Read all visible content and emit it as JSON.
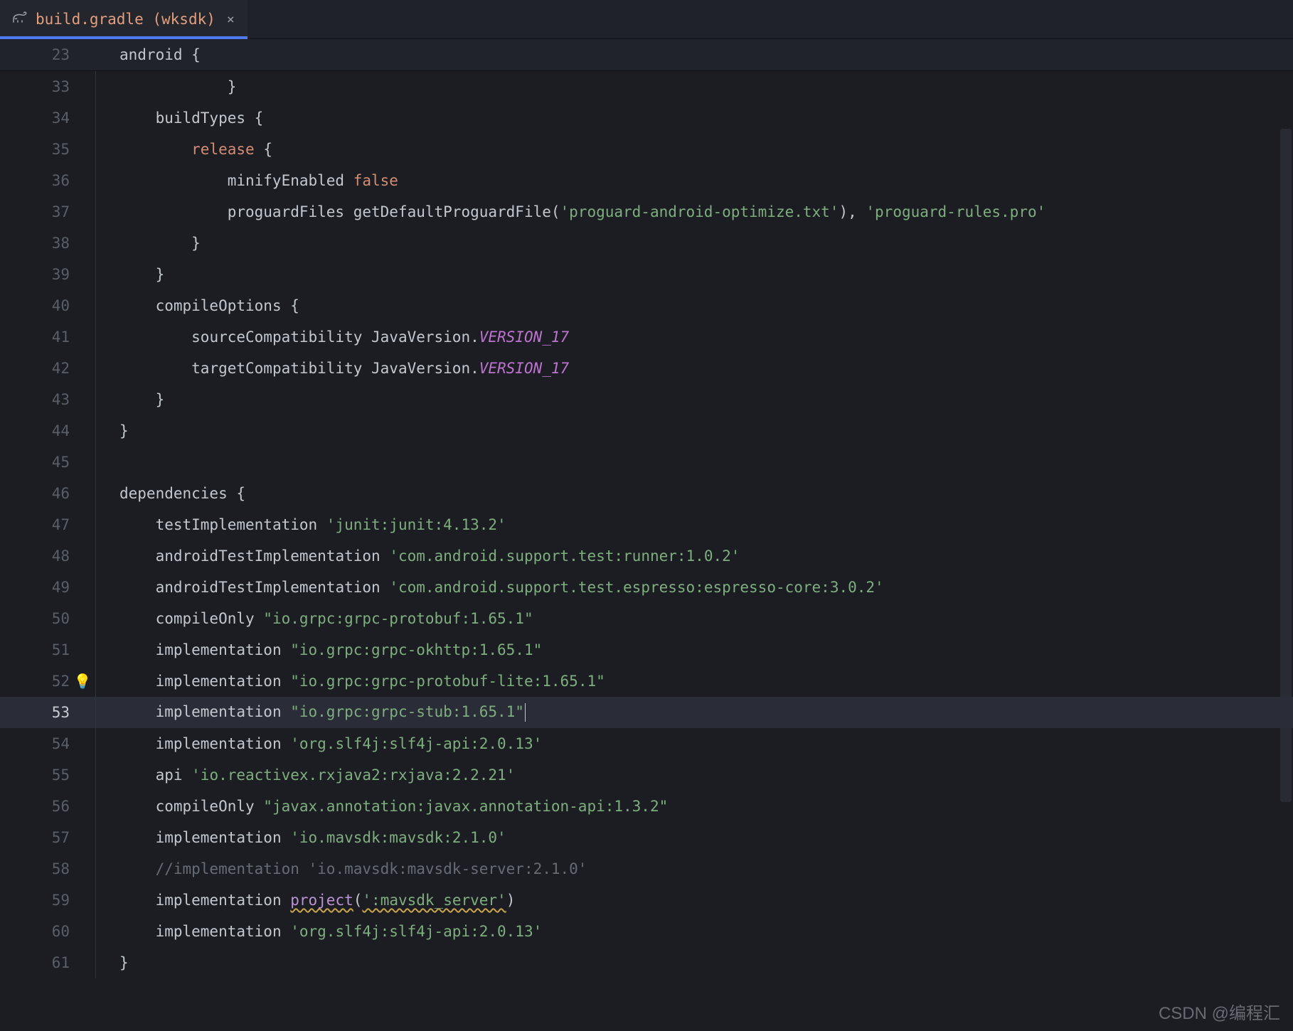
{
  "tab": {
    "file_name": "build.gradle",
    "module": "(wksdk)",
    "close_glyph": "×"
  },
  "sticky": {
    "line_no": "23",
    "tokens": [
      {
        "cls": "name",
        "t": "android "
      },
      {
        "cls": "punct",
        "t": "{"
      }
    ]
  },
  "bulb_glyph": "💡",
  "watermark": "CSDN @编程汇",
  "lines": [
    {
      "n": "33",
      "indent": 3,
      "tokens": [
        {
          "cls": "punct",
          "t": "}"
        }
      ]
    },
    {
      "n": "34",
      "indent": 1,
      "tokens": [
        {
          "cls": "name",
          "t": "buildTypes "
        },
        {
          "cls": "punct",
          "t": "{"
        }
      ]
    },
    {
      "n": "35",
      "indent": 2,
      "tokens": [
        {
          "cls": "kw",
          "t": "release"
        },
        {
          "cls": "punct",
          "t": " {"
        }
      ]
    },
    {
      "n": "36",
      "indent": 3,
      "tokens": [
        {
          "cls": "name",
          "t": "minifyEnabled "
        },
        {
          "cls": "kw",
          "t": "false"
        }
      ]
    },
    {
      "n": "37",
      "indent": 3,
      "tokens": [
        {
          "cls": "name",
          "t": "proguardFiles getDefaultProguardFile("
        },
        {
          "cls": "str",
          "t": "'proguard-android-optimize.txt'"
        },
        {
          "cls": "name",
          "t": "), "
        },
        {
          "cls": "str",
          "t": "'proguard-rules.pro'"
        }
      ]
    },
    {
      "n": "38",
      "indent": 2,
      "tokens": [
        {
          "cls": "punct",
          "t": "}"
        }
      ]
    },
    {
      "n": "39",
      "indent": 1,
      "tokens": [
        {
          "cls": "punct",
          "t": "}"
        }
      ]
    },
    {
      "n": "40",
      "indent": 1,
      "tokens": [
        {
          "cls": "name",
          "t": "compileOptions "
        },
        {
          "cls": "punct",
          "t": "{"
        }
      ]
    },
    {
      "n": "41",
      "indent": 2,
      "tokens": [
        {
          "cls": "name",
          "t": "sourceCompatibility JavaVersion."
        },
        {
          "cls": "const",
          "t": "VERSION_17"
        }
      ]
    },
    {
      "n": "42",
      "indent": 2,
      "tokens": [
        {
          "cls": "name",
          "t": "targetCompatibility JavaVersion."
        },
        {
          "cls": "const",
          "t": "VERSION_17"
        }
      ]
    },
    {
      "n": "43",
      "indent": 1,
      "tokens": [
        {
          "cls": "punct",
          "t": "}"
        }
      ]
    },
    {
      "n": "44",
      "indent": 0,
      "tokens": [
        {
          "cls": "punct",
          "t": "}"
        }
      ]
    },
    {
      "n": "45",
      "indent": 0,
      "tokens": []
    },
    {
      "n": "46",
      "indent": 0,
      "tokens": [
        {
          "cls": "name",
          "t": "dependencies "
        },
        {
          "cls": "punct",
          "t": "{"
        }
      ]
    },
    {
      "n": "47",
      "indent": 1,
      "tokens": [
        {
          "cls": "name",
          "t": "testImplementation "
        },
        {
          "cls": "str",
          "t": "'junit:junit:4.13.2'"
        }
      ]
    },
    {
      "n": "48",
      "indent": 1,
      "tokens": [
        {
          "cls": "name",
          "t": "androidTestImplementation "
        },
        {
          "cls": "str",
          "t": "'com.android.support.test:runner:1.0.2'"
        }
      ]
    },
    {
      "n": "49",
      "indent": 1,
      "tokens": [
        {
          "cls": "name",
          "t": "androidTestImplementation "
        },
        {
          "cls": "str",
          "t": "'com.android.support.test.espresso:espresso-core:3.0.2'"
        }
      ]
    },
    {
      "n": "50",
      "indent": 1,
      "tokens": [
        {
          "cls": "name",
          "t": "compileOnly "
        },
        {
          "cls": "strdq",
          "t": "\"io.grpc:grpc-protobuf:1.65.1\""
        }
      ]
    },
    {
      "n": "51",
      "indent": 1,
      "tokens": [
        {
          "cls": "name",
          "t": "implementation "
        },
        {
          "cls": "strdq",
          "t": "\"io.grpc:grpc-okhttp:1.65.1\""
        }
      ]
    },
    {
      "n": "52",
      "indent": 1,
      "bulb": true,
      "tokens": [
        {
          "cls": "name",
          "t": "implementation "
        },
        {
          "cls": "strdq",
          "t": "\"io.grpc:grpc-protobuf-lite:1.65.1\""
        }
      ]
    },
    {
      "n": "53",
      "indent": 1,
      "current": true,
      "cursor_after": true,
      "tokens": [
        {
          "cls": "name",
          "t": "implementation "
        },
        {
          "cls": "strdq",
          "t": "\"io.grpc:grpc-stub:1.65.1\""
        }
      ]
    },
    {
      "n": "54",
      "indent": 1,
      "tokens": [
        {
          "cls": "name",
          "t": "implementation "
        },
        {
          "cls": "str",
          "t": "'org.slf4j:slf4j-api:2.0.13'"
        }
      ]
    },
    {
      "n": "55",
      "indent": 1,
      "tokens": [
        {
          "cls": "name",
          "t": "api "
        },
        {
          "cls": "str",
          "t": "'io.reactivex.rxjava2:rxjava:2.2.21'"
        }
      ]
    },
    {
      "n": "56",
      "indent": 1,
      "tokens": [
        {
          "cls": "name",
          "t": "compileOnly "
        },
        {
          "cls": "strdq",
          "t": "\"javax.annotation:javax.annotation-api:1.3.2\""
        }
      ]
    },
    {
      "n": "57",
      "indent": 1,
      "tokens": [
        {
          "cls": "name",
          "t": "implementation "
        },
        {
          "cls": "str",
          "t": "'io.mavsdk:mavsdk:2.1.0'"
        }
      ]
    },
    {
      "n": "58",
      "indent": 1,
      "tokens": [
        {
          "cls": "comment",
          "t": "//implementation 'io.mavsdk:mavsdk-server:2.1.0'"
        }
      ]
    },
    {
      "n": "59",
      "indent": 1,
      "tokens": [
        {
          "cls": "name",
          "t": "implementation "
        },
        {
          "cls": "project-call warn-underline",
          "t": "project"
        },
        {
          "cls": "name",
          "t": "("
        },
        {
          "cls": "str warn-underline",
          "t": "':mavsdk_server'"
        },
        {
          "cls": "name",
          "t": ")"
        }
      ]
    },
    {
      "n": "60",
      "indent": 1,
      "tokens": [
        {
          "cls": "name",
          "t": "implementation "
        },
        {
          "cls": "str",
          "t": "'org.slf4j:slf4j-api:2.0.13'"
        }
      ]
    },
    {
      "n": "61",
      "indent": 0,
      "tokens": [
        {
          "cls": "punct",
          "t": "}"
        }
      ]
    }
  ]
}
